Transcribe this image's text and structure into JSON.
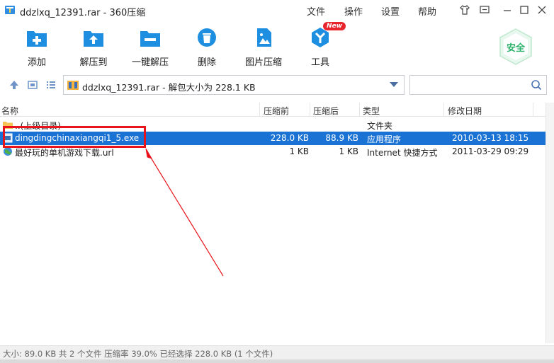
{
  "window": {
    "title": "ddzlxq_12391.rar - 360压缩",
    "menus": [
      "文件",
      "操作",
      "设置",
      "帮助"
    ]
  },
  "toolbar": {
    "items": [
      {
        "label": "添加",
        "icon": "add-icon"
      },
      {
        "label": "解压到",
        "icon": "extract-to-icon"
      },
      {
        "label": "一键解压",
        "icon": "one-click-extract-icon"
      },
      {
        "label": "删除",
        "icon": "delete-icon"
      },
      {
        "label": "图片压缩",
        "icon": "image-compress-icon"
      },
      {
        "label": "工具",
        "icon": "tools-icon"
      }
    ],
    "new_badge": "New",
    "safe_label": "安全"
  },
  "address": {
    "text": "ddzlxq_12391.rar - 解包大小为 228.1 KB"
  },
  "columns": {
    "name": "名称",
    "compressed_before": "压缩前",
    "compressed_after": "压缩后",
    "type": "类型",
    "modified": "修改日期"
  },
  "rows": [
    {
      "name": "..(上级目录)",
      "before": "",
      "after": "",
      "type": "文件夹",
      "modified": "",
      "icon": "folder-icon"
    },
    {
      "name": "dingdingchinaxiangqi1_5.exe",
      "before": "228.0 KB",
      "after": "88.9 KB",
      "type": "应用程序",
      "modified": "2010-03-13 18:15",
      "icon": "exe-icon"
    },
    {
      "name": "最好玩的单机游戏下载.url",
      "before": "1 KB",
      "after": "1 KB",
      "type": "Internet 快捷方式",
      "modified": "2011-03-29 09:29",
      "icon": "internet-shortcut-icon"
    }
  ],
  "status": {
    "text": "大小: 89.0 KB 共 2 个文件 压缩率 39.0% 已经选择 228.0 KB (1 个文件)"
  },
  "colors": {
    "selection": "#1a73d4",
    "annotation_red": "#e8141b",
    "accent_blue": "#1e8fe0",
    "safe_green": "#2ab26a"
  }
}
